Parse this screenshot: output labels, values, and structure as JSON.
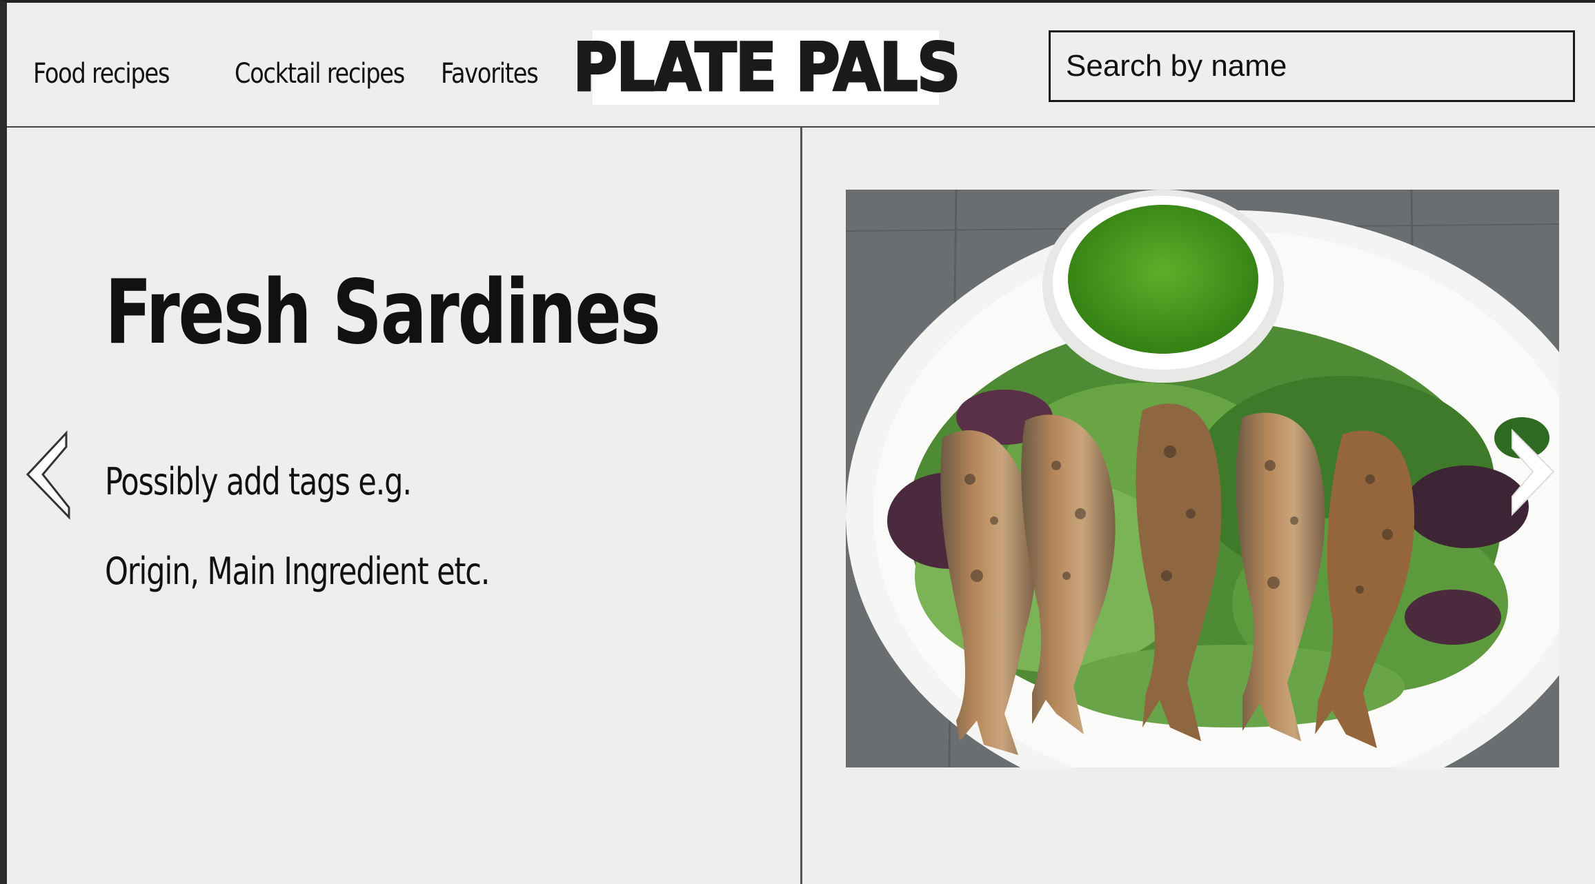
{
  "nav": {
    "items": [
      "Food recipes",
      "Cocktail recipes",
      "Favorites"
    ]
  },
  "logo": {
    "text": "PLATE PALS"
  },
  "search": {
    "placeholder": "Search by name"
  },
  "recipe": {
    "title": "Fresh Sardines",
    "tag_line_1": "Possibly add tags e.g.",
    "tag_line_2": "Origin, Main Ingredient etc."
  },
  "icons": {
    "prev": "chevron-left-icon",
    "next": "chevron-right-icon"
  },
  "colors": {
    "background": "#eeeeee",
    "text": "#111111",
    "border": "#1a1a1a"
  }
}
